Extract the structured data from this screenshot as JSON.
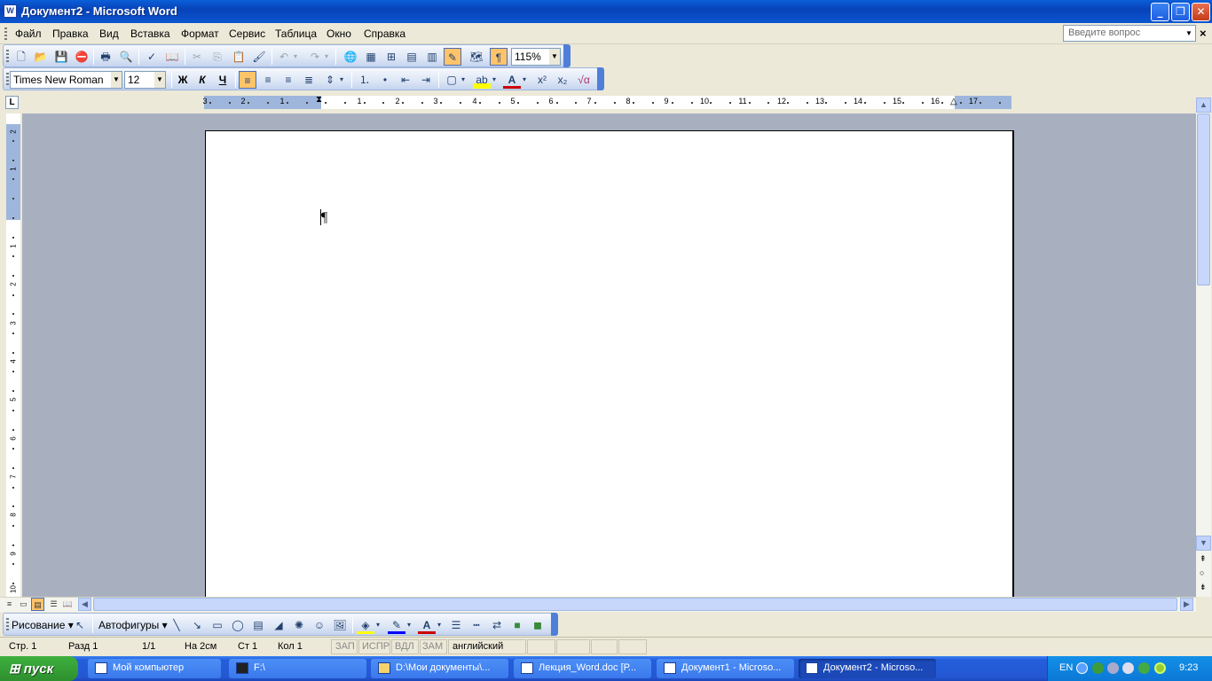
{
  "window": {
    "title": "Документ2 - Microsoft Word",
    "icon_text": "W"
  },
  "menu": {
    "items": [
      "Файл",
      "Правка",
      "Вид",
      "Вставка",
      "Формат",
      "Сервис",
      "Таблица",
      "Окно",
      "Справка"
    ],
    "ask_placeholder": "Введите вопрос"
  },
  "standard_toolbar": {
    "zoom": "115%"
  },
  "format_toolbar": {
    "font": "Times New Roman",
    "size": "12",
    "bold": "Ж",
    "italic": "К",
    "underline": "Ч"
  },
  "ruler": {
    "h_numbers": [
      "3",
      "2",
      "1",
      "1",
      "2",
      "3",
      "4",
      "5",
      "6",
      "7",
      "8",
      "9",
      "10",
      "11",
      "12",
      "13",
      "14",
      "15",
      "16",
      "17"
    ],
    "v_numbers": [
      "2",
      "1",
      "1",
      "2",
      "3",
      "4",
      "5",
      "6",
      "7",
      "8",
      "9",
      "10"
    ]
  },
  "document": {
    "pilcrow": "¶"
  },
  "drawing_toolbar": {
    "draw_label": "Рисование",
    "autoshapes_label": "Автофигуры"
  },
  "status": {
    "page": "Стр. 1",
    "section": "Разд 1",
    "pages": "1/1",
    "at": "На 2см",
    "line": "Ст 1",
    "col": "Кол 1",
    "rec": "ЗАП",
    "trk": "ИСПР",
    "ext": "ВДЛ",
    "ovr": "ЗАМ",
    "lang": "английский"
  },
  "taskbar": {
    "start": "пуск",
    "tasks": [
      "Мой компьютер",
      "F:\\",
      "D:\\Мои документы\\...",
      "Лекция_Word.doc [Р...",
      "Документ1 - Microso...",
      "Документ2 - Microso..."
    ],
    "lang": "EN",
    "clock": "9:23"
  }
}
